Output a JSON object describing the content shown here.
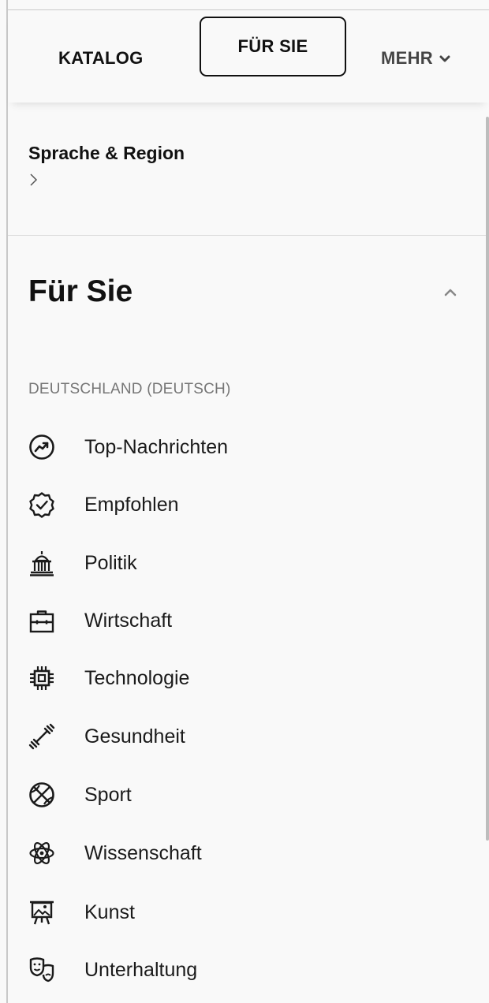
{
  "nav": {
    "items": [
      "KATALOG",
      "FÜR SIE",
      "MEHR"
    ]
  },
  "language": {
    "title": "Sprache & Region"
  },
  "section": {
    "title": "Für Sie",
    "region": "DEUTSCHLAND (DEUTSCH)",
    "categories": [
      {
        "label": "Top-Nachrichten",
        "icon": "trending-icon"
      },
      {
        "label": "Empfohlen",
        "icon": "badge-check-icon"
      },
      {
        "label": "Politik",
        "icon": "capitol-icon"
      },
      {
        "label": "Wirtschaft",
        "icon": "briefcase-icon"
      },
      {
        "label": "Technologie",
        "icon": "chip-icon"
      },
      {
        "label": "Gesundheit",
        "icon": "dumbbell-icon"
      },
      {
        "label": "Sport",
        "icon": "basketball-icon"
      },
      {
        "label": "Wissenschaft",
        "icon": "atom-icon"
      },
      {
        "label": "Kunst",
        "icon": "easel-icon"
      },
      {
        "label": "Unterhaltung",
        "icon": "theater-masks-icon"
      }
    ]
  },
  "colors": {
    "text": "#1a1a1a",
    "muted": "#767676",
    "background": "#f9f9f9"
  }
}
